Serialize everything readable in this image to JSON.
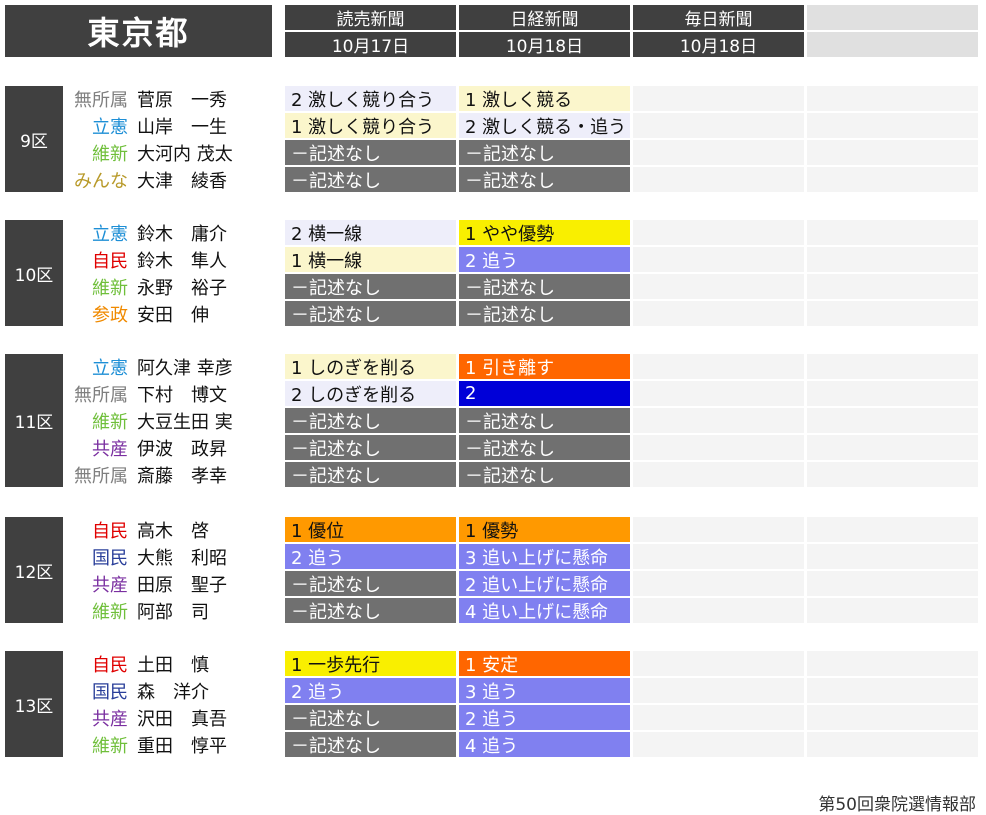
{
  "title": "東京都",
  "columns": [
    {
      "name": "読売新聞",
      "date": "10月17日"
    },
    {
      "name": "日経新聞",
      "date": "10月18日"
    },
    {
      "name": "毎日新聞",
      "date": "10月18日"
    },
    {
      "name": "",
      "date": ""
    }
  ],
  "colors": {
    "無所属": "#7f7f7f",
    "立憲": "#1e8fd6",
    "維新": "#6fbf3a",
    "みんな": "#b89a2a",
    "自民": "#e00000",
    "参政": "#f08a00",
    "共産": "#7a2fa0",
    "国民": "#2a3f9a"
  },
  "cell_styles": {
    "lightblue": {
      "bg": "#eeeefa",
      "fg": "#111111"
    },
    "lightyellow": {
      "bg": "#fbf6cc",
      "fg": "#111111"
    },
    "gray": {
      "bg": "#707070",
      "fg": "#ffffff"
    },
    "yellow": {
      "bg": "#f9ef00",
      "fg": "#111111"
    },
    "periwinkle": {
      "bg": "#8080f0",
      "fg": "#ffffff"
    },
    "orangered": {
      "bg": "#ff6600",
      "fg": "#ffffff"
    },
    "blue": {
      "bg": "#0000d8",
      "fg": "#ffffff"
    },
    "orange": {
      "bg": "#ff9900",
      "fg": "#111111"
    }
  },
  "sections": [
    {
      "district": "9区",
      "rows": [
        {
          "party": "無所属",
          "name": "菅原　一秀",
          "c1": {
            "text": "2 激しく競り合う",
            "style": "lightblue"
          },
          "c2": {
            "text": "1 激しく競る",
            "style": "lightyellow"
          }
        },
        {
          "party": "立憲",
          "name": "山岸　一生",
          "c1": {
            "text": "1 激しく競り合う",
            "style": "lightyellow"
          },
          "c2": {
            "text": "2 激しく競る・追う",
            "style": "lightblue"
          }
        },
        {
          "party": "維新",
          "name": "大河内 茂太",
          "c1": {
            "text": "－記述なし",
            "style": "gray"
          },
          "c2": {
            "text": "－記述なし",
            "style": "gray"
          }
        },
        {
          "party": "みんな",
          "name": "大津　綾香",
          "c1": {
            "text": "－記述なし",
            "style": "gray"
          },
          "c2": {
            "text": "－記述なし",
            "style": "gray"
          }
        }
      ]
    },
    {
      "district": "10区",
      "rows": [
        {
          "party": "立憲",
          "name": "鈴木　庸介",
          "c1": {
            "text": "2 横一線",
            "style": "lightblue"
          },
          "c2": {
            "text": "1 やや優勢",
            "style": "yellow"
          }
        },
        {
          "party": "自民",
          "name": "鈴木　隼人",
          "c1": {
            "text": "1 横一線",
            "style": "lightyellow"
          },
          "c2": {
            "text": "2 追う",
            "style": "periwinkle"
          }
        },
        {
          "party": "維新",
          "name": "永野　裕子",
          "c1": {
            "text": "－記述なし",
            "style": "gray"
          },
          "c2": {
            "text": "－記述なし",
            "style": "gray"
          }
        },
        {
          "party": "参政",
          "name": "安田　伸",
          "c1": {
            "text": "－記述なし",
            "style": "gray"
          },
          "c2": {
            "text": "－記述なし",
            "style": "gray"
          }
        }
      ]
    },
    {
      "district": "11区",
      "rows": [
        {
          "party": "立憲",
          "name": "阿久津 幸彦",
          "c1": {
            "text": "1 しのぎを削る",
            "style": "lightyellow"
          },
          "c2": {
            "text": "1 引き離す",
            "style": "orangered"
          }
        },
        {
          "party": "無所属",
          "name": "下村　博文",
          "c1": {
            "text": "2 しのぎを削る",
            "style": "lightblue"
          },
          "c2": {
            "text": "2",
            "style": "blue"
          }
        },
        {
          "party": "維新",
          "name": "大豆生田 実",
          "c1": {
            "text": "－記述なし",
            "style": "gray"
          },
          "c2": {
            "text": "－記述なし",
            "style": "gray"
          }
        },
        {
          "party": "共産",
          "name": "伊波　政昇",
          "c1": {
            "text": "－記述なし",
            "style": "gray"
          },
          "c2": {
            "text": "－記述なし",
            "style": "gray"
          }
        },
        {
          "party": "無所属",
          "name": "斎藤　孝幸",
          "c1": {
            "text": "－記述なし",
            "style": "gray"
          },
          "c2": {
            "text": "－記述なし",
            "style": "gray"
          }
        }
      ]
    },
    {
      "district": "12区",
      "rows": [
        {
          "party": "自民",
          "name": "高木　啓",
          "c1": {
            "text": "1 優位",
            "style": "orange"
          },
          "c2": {
            "text": "1 優勢",
            "style": "orange"
          }
        },
        {
          "party": "国民",
          "name": "大熊　利昭",
          "c1": {
            "text": "2 追う",
            "style": "periwinkle"
          },
          "c2": {
            "text": "3 追い上げに懸命",
            "style": "periwinkle"
          }
        },
        {
          "party": "共産",
          "name": "田原　聖子",
          "c1": {
            "text": "－記述なし",
            "style": "gray"
          },
          "c2": {
            "text": "2 追い上げに懸命",
            "style": "periwinkle"
          }
        },
        {
          "party": "維新",
          "name": "阿部　司",
          "c1": {
            "text": "－記述なし",
            "style": "gray"
          },
          "c2": {
            "text": "4 追い上げに懸命",
            "style": "periwinkle"
          }
        }
      ]
    },
    {
      "district": "13区",
      "rows": [
        {
          "party": "自民",
          "name": "土田　慎",
          "c1": {
            "text": "1 一歩先行",
            "style": "yellow"
          },
          "c2": {
            "text": "1 安定",
            "style": "orangered"
          }
        },
        {
          "party": "国民",
          "name": "森　洋介",
          "c1": {
            "text": "2 追う",
            "style": "periwinkle"
          },
          "c2": {
            "text": "3 追う",
            "style": "periwinkle"
          }
        },
        {
          "party": "共産",
          "name": "沢田　真吾",
          "c1": {
            "text": "－記述なし",
            "style": "gray"
          },
          "c2": {
            "text": "2 追う",
            "style": "periwinkle"
          }
        },
        {
          "party": "維新",
          "name": "重田　惇平",
          "c1": {
            "text": "－記述なし",
            "style": "gray"
          },
          "c2": {
            "text": "4 追う",
            "style": "periwinkle"
          }
        }
      ]
    }
  ],
  "footer": "第50回衆院選情報部"
}
